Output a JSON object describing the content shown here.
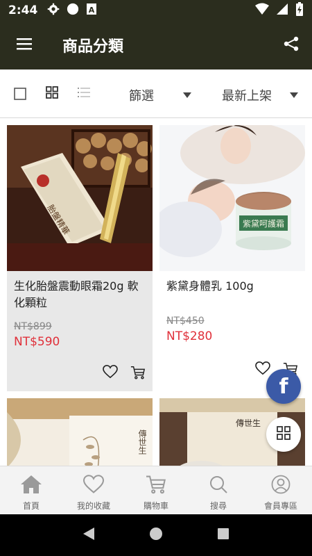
{
  "status_bar": {
    "time": "2:44"
  },
  "app_bar": {
    "title": "商品分類"
  },
  "toolbar": {
    "filter_label": "篩選",
    "sort_label": "最新上架"
  },
  "products": [
    {
      "name": "生化胎盤震動眼霜20g 軟化顆粒",
      "old_price": "NT$899",
      "new_price": "NT$590"
    },
    {
      "name": "紫黛身體乳 100g",
      "old_price": "NT$450",
      "new_price": "NT$280"
    },
    {
      "name": "",
      "old_price": "",
      "new_price": ""
    },
    {
      "name": "",
      "old_price": "",
      "new_price": ""
    }
  ],
  "product_image_text": {
    "p1_box": "胎盤精華",
    "p2_jar": "紫黛呵護霜",
    "p3_box": "傳世生",
    "p4_box": "傳世生"
  },
  "bottom_nav": [
    {
      "label": "首頁",
      "icon": "home-icon"
    },
    {
      "label": "我的收藏",
      "icon": "heart-icon"
    },
    {
      "label": "購物車",
      "icon": "cart-icon"
    },
    {
      "label": "搜尋",
      "icon": "search-icon"
    },
    {
      "label": "會員專區",
      "icon": "user-icon"
    }
  ],
  "colors": {
    "app_bar": "#2b2d1e",
    "price_red": "#e0303a",
    "facebook": "#3b5aa7",
    "card_selected_bg": "#e8e8e8"
  }
}
